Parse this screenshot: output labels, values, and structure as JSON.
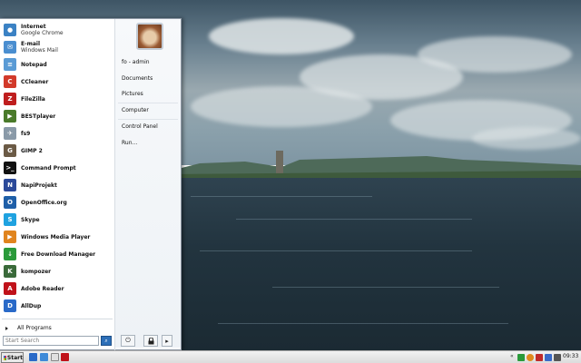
{
  "start_menu": {
    "programs": [
      {
        "name": "Internet",
        "sub": "Google Chrome",
        "icon": "chrome-icon",
        "color": "#3b82c4"
      },
      {
        "name": "E-mail",
        "sub": "Windows Mail",
        "icon": "mail-icon",
        "color": "#4a8ed0"
      },
      {
        "name": "Notepad",
        "sub": "",
        "icon": "notepad-icon",
        "color": "#5a9bd5"
      },
      {
        "name": "CCleaner",
        "sub": "",
        "icon": "ccleaner-icon",
        "color": "#d23a2a"
      },
      {
        "name": "FileZilla",
        "sub": "",
        "icon": "filezilla-icon",
        "color": "#bf1e1e"
      },
      {
        "name": "BESTplayer",
        "sub": "",
        "icon": "bestplayer-icon",
        "color": "#4a7a2a"
      },
      {
        "name": "fs9",
        "sub": "",
        "icon": "airplane-icon",
        "color": "#8a9aa8"
      },
      {
        "name": "GIMP 2",
        "sub": "",
        "icon": "gimp-icon",
        "color": "#6b5a45"
      },
      {
        "name": "Command Prompt",
        "sub": "",
        "icon": "terminal-icon",
        "color": "#111111"
      },
      {
        "name": "NapiProjekt",
        "sub": "",
        "icon": "napiprojekt-icon",
        "color": "#2b4a9a"
      },
      {
        "name": "OpenOffice.org",
        "sub": "",
        "icon": "openoffice-icon",
        "color": "#1f5fa8"
      },
      {
        "name": "Skype",
        "sub": "",
        "icon": "skype-icon",
        "color": "#1fa2e0"
      },
      {
        "name": "Windows Media Player",
        "sub": "",
        "icon": "media-player-icon",
        "color": "#e0841e"
      },
      {
        "name": "Free Download Manager",
        "sub": "",
        "icon": "download-manager-icon",
        "color": "#2a9a3a"
      },
      {
        "name": "kompozer",
        "sub": "",
        "icon": "kompozer-icon",
        "color": "#3a6a3a"
      },
      {
        "name": "Adobe Reader",
        "sub": "",
        "icon": "adobe-reader-icon",
        "color": "#c0121a"
      },
      {
        "name": "AllDup",
        "sub": "",
        "icon": "alldup-icon",
        "color": "#2a6ac8"
      }
    ],
    "all_programs": "All Programs",
    "search_placeholder": "Start Search",
    "places": [
      "fo - admin",
      "Documents",
      "Pictures",
      "Computer",
      "Control Panel",
      "Run..."
    ]
  },
  "taskbar": {
    "start_label": "Start",
    "clock": "09:33"
  }
}
